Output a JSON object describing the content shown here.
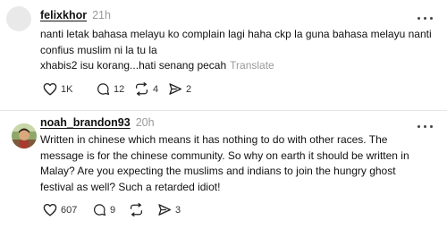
{
  "posts": [
    {
      "username": "felixkhor",
      "timestamp": "21h",
      "lines": [
        "nanti letak bahasa melayu ko complain lagi haha ckp la guna bahasa melayu nanti",
        "confius muslim ni la tu la",
        "xhabis2 isu korang...hati senang pecah"
      ],
      "translate_label": "Translate",
      "likes": "1K",
      "replies": "12",
      "reposts": "4",
      "shares": "2"
    },
    {
      "username": "noah_brandon93",
      "timestamp": "20h",
      "lines": [
        "Written in chinese which means it has nothing to do with other races. The",
        "message is for the chinese community. So why on earth it should be written in",
        "Malay? Are you expecting the muslims and indians to join the hungry ghost",
        "festival as well? Such a retarded idiot!"
      ],
      "likes": "607",
      "replies": "9",
      "shares": "3"
    }
  ],
  "icons": {
    "like": "heart-icon",
    "reply": "comment-icon",
    "repost": "repost-icon",
    "share": "share-icon",
    "more": "more-icon"
  }
}
